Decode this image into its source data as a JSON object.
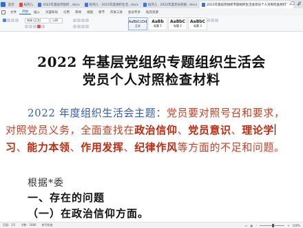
{
  "tabs": [
    {
      "label": "首页",
      "active": false
    },
    {
      "label": "稻壳儿",
      "active": false
    },
    {
      "label": "2022年基层党组织...docx",
      "active": false
    },
    {
      "label": "稻壳儿 · 2022年度组织生活...docx",
      "active": false
    },
    {
      "label": "稻壳儿 · 2022年度党员检视...docx",
      "active": false
    },
    {
      "label": "2022年基层党组织专题组织生活会党员个人对照检查材料",
      "active": true
    }
  ],
  "menus": [
    "文件",
    "开始",
    "插入",
    "页面布局",
    "引用",
    "审阅",
    "视图",
    "章节",
    "开发工具",
    "会员专享",
    "稻壳资源"
  ],
  "active_menu": "开始",
  "ribbon": {
    "font_name": "宋体 (正文)",
    "font_size": "小四",
    "styles": [
      {
        "sample": "AaBbCcDd",
        "name": "正文"
      },
      {
        "sample": "AaBb",
        "name": "标题 1"
      },
      {
        "sample": "AaBbC",
        "name": "标题 2"
      },
      {
        "sample": "AaBbC",
        "name": "标题 3"
      }
    ]
  },
  "document": {
    "title_line1": "2022 年基层党组织专题组织生活会",
    "title_line2": "党员个人对照检查材料",
    "p1_label": "2022 年度组织生活会主题：",
    "p1_text": "党员要对照号召和要求，",
    "p2_a": "对照党员义务，全面查找在",
    "p2_b1": "政治信仰",
    "p2_sep1": "、",
    "p2_b2": "党员意识",
    "p2_sep2": "、",
    "p2_b3": "理论学",
    "p3_b1": "习",
    "p3_sep1": "、",
    "p3_b2": "能力本领",
    "p3_sep2": "、",
    "p3_b3": "作用发挥",
    "p3_sep3": "、",
    "p3_b4": "纪律作风",
    "p3_c": "等方面的不足和问题。",
    "basis": "根据*委",
    "section1": "一、存在的问题",
    "section1_1": "（一）在政治信仰方面。"
  },
  "status": {
    "page": "页面：1/5",
    "words": "字数：2686",
    "spell": "拼写检查",
    "zoom": "100%"
  }
}
